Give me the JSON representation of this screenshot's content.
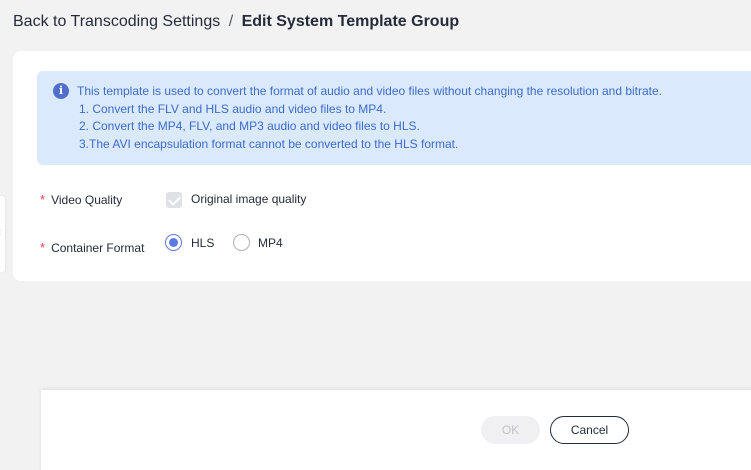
{
  "header": {
    "back_label": "Back to Transcoding Settings",
    "separator": "/",
    "title": "Edit System Template Group"
  },
  "side_handle": {
    "icon": "chevron-left-icon",
    "glyph": "‹"
  },
  "alert": {
    "icon": "info-icon",
    "icon_glyph": "i",
    "lines": [
      "This template is used to convert the format of audio and video files without changing the resolution and bitrate.",
      "1. Convert the FLV and HLS audio and video files to MP4.",
      "2. Convert the MP4, FLV, and MP3 audio and video files to HLS.",
      "3.The AVI encapsulation format cannot be converted to the HLS format."
    ]
  },
  "form": {
    "required_mark": "*",
    "video_quality": {
      "label": "Video Quality",
      "option_label": "Original image quality",
      "checked": true,
      "disabled": true
    },
    "container_format": {
      "label": "Container Format",
      "options": [
        {
          "label": "HLS",
          "selected": true
        },
        {
          "label": "MP4",
          "selected": false
        }
      ]
    }
  },
  "footer": {
    "ok_label": "OK",
    "ok_disabled": true,
    "cancel_label": "Cancel"
  },
  "colors": {
    "accent": "#5e7ce0",
    "alert_bg": "#dbe9fd",
    "alert_text": "#3c6cc9",
    "required": "#e54545",
    "page_bg": "#f2f2f2"
  }
}
